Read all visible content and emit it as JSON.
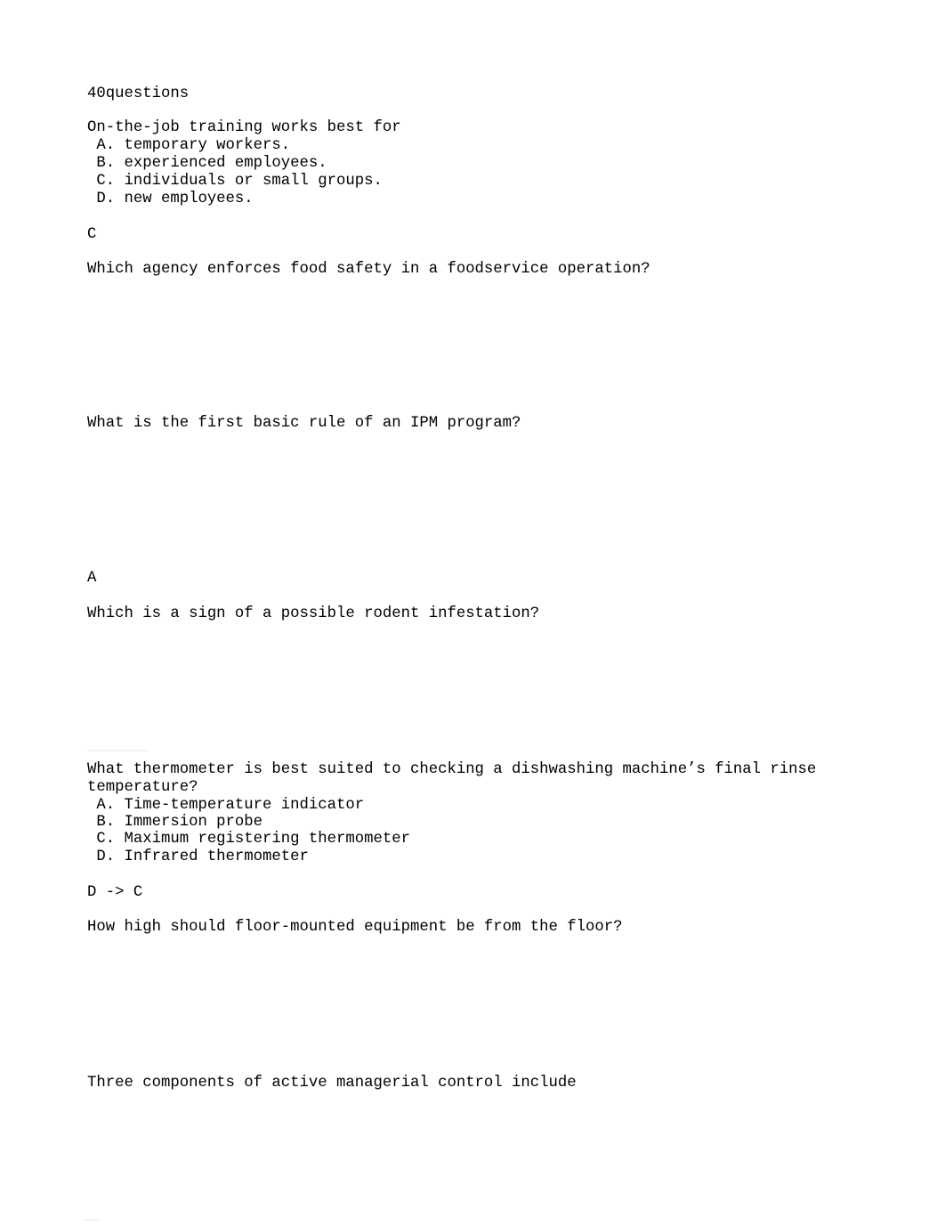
{
  "document": {
    "header": "40questions",
    "questions": [
      {
        "text": "On-the-job training works best for",
        "options": [
          " A. temporary workers.",
          " B. experienced employees.",
          " C. individuals or small groups.",
          " D. new employees."
        ],
        "answer": "C"
      },
      {
        "text": "Which agency enforces food safety in a foodservice operation?"
      },
      {
        "text": "What is the first basic rule of an IPM program?",
        "answer": "A"
      },
      {
        "text": "Which is a sign of a possible rodent infestation?"
      },
      {
        "text_line1": "What thermometer is best suited to checking a dishwashing machine’s final rinse",
        "text_line2": "temperature?",
        "options": [
          " A. Time-temperature indicator",
          " B. Immersion probe",
          " C. Maximum registering thermometer",
          " D. Infrared thermometer"
        ],
        "answer": "D -> C"
      },
      {
        "text": "How high should floor-mounted equipment be from the floor?"
      },
      {
        "text": "Three components of active managerial control include"
      }
    ]
  }
}
